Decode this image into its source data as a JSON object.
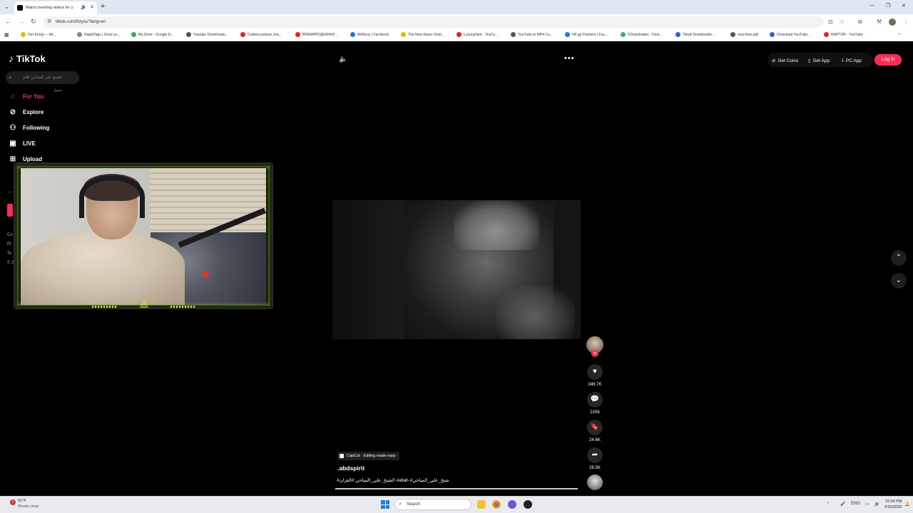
{
  "browser": {
    "tab_title": "Watch trending videos for y",
    "url": "tiktok.com/foryou?lang=en",
    "bookmarks": [
      {
        "label": "Get Emoji — All..."
      },
      {
        "label": "RapidTags | Grow yo..."
      },
      {
        "label": "My Drive - Google D..."
      },
      {
        "label": "Youtube Downloade..."
      },
      {
        "label": "Outlast parkour cha..."
      },
      {
        "label": "ВРЕМЯПОДКАНАЛ..."
      },
      {
        "label": "MrRicoy | Facebook"
      },
      {
        "label": "The New Razer Gold..."
      },
      {
        "label": "LuxuryDark - YouTu..."
      },
      {
        "label": "YouTube to MP4 Co..."
      },
      {
        "label": "FB gg Partners | Fac..."
      },
      {
        "label": "FDownloader - Dow..."
      },
      {
        "label": "Tiktok Downloader..."
      },
      {
        "label": "visa-form.pdf"
      },
      {
        "label": "Download YouTube..."
      },
      {
        "label": "RAPTOR - YouTube"
      }
    ]
  },
  "tiktok": {
    "logo": "TikTok",
    "search_placeholder": "الشيخ علي المياحي كلام جميل",
    "nav": [
      {
        "label": "For You",
        "icon": "home-icon",
        "active": true
      },
      {
        "label": "Explore",
        "icon": "compass-icon"
      },
      {
        "label": "Following",
        "icon": "people-icon"
      },
      {
        "label": "LIVE",
        "icon": "live-icon"
      },
      {
        "label": "Upload",
        "icon": "plus-square-icon"
      }
    ],
    "footer_fragments": [
      "Co",
      "Pr",
      "Te",
      "© 2"
    ],
    "top_actions": {
      "get_coins": "Get Coins",
      "get_app": "Get App",
      "pc_app": "PC App",
      "login": "Log in"
    },
    "video": {
      "capcut_badge": "CapCut · Editing made easy",
      "author": ".abdspirit",
      "caption_parts": [
        "#شيخ_علي_المياحي",
        "#allah",
        "#الشيخ_علي_المياحي",
        "#القران"
      ],
      "caption": "#الشيخ_علي_المياحي #القران #allah #شيخ_علي_المياحي",
      "progress_fraction": 1.0
    },
    "rail": {
      "likes": "346.7K",
      "comments": "2256",
      "saves": "24.6K",
      "shares": "26.5K"
    }
  },
  "taskbar": {
    "weather_temp": "51°F",
    "weather_desc": "Mostly clear",
    "search_label": "Search",
    "lang": "ENG",
    "time": "10:24 PM",
    "date": "2/25/2026"
  },
  "colors": {
    "accent": "#fe2c55",
    "background": "#000000",
    "webcam_frame_accent": "#c8e83a"
  }
}
